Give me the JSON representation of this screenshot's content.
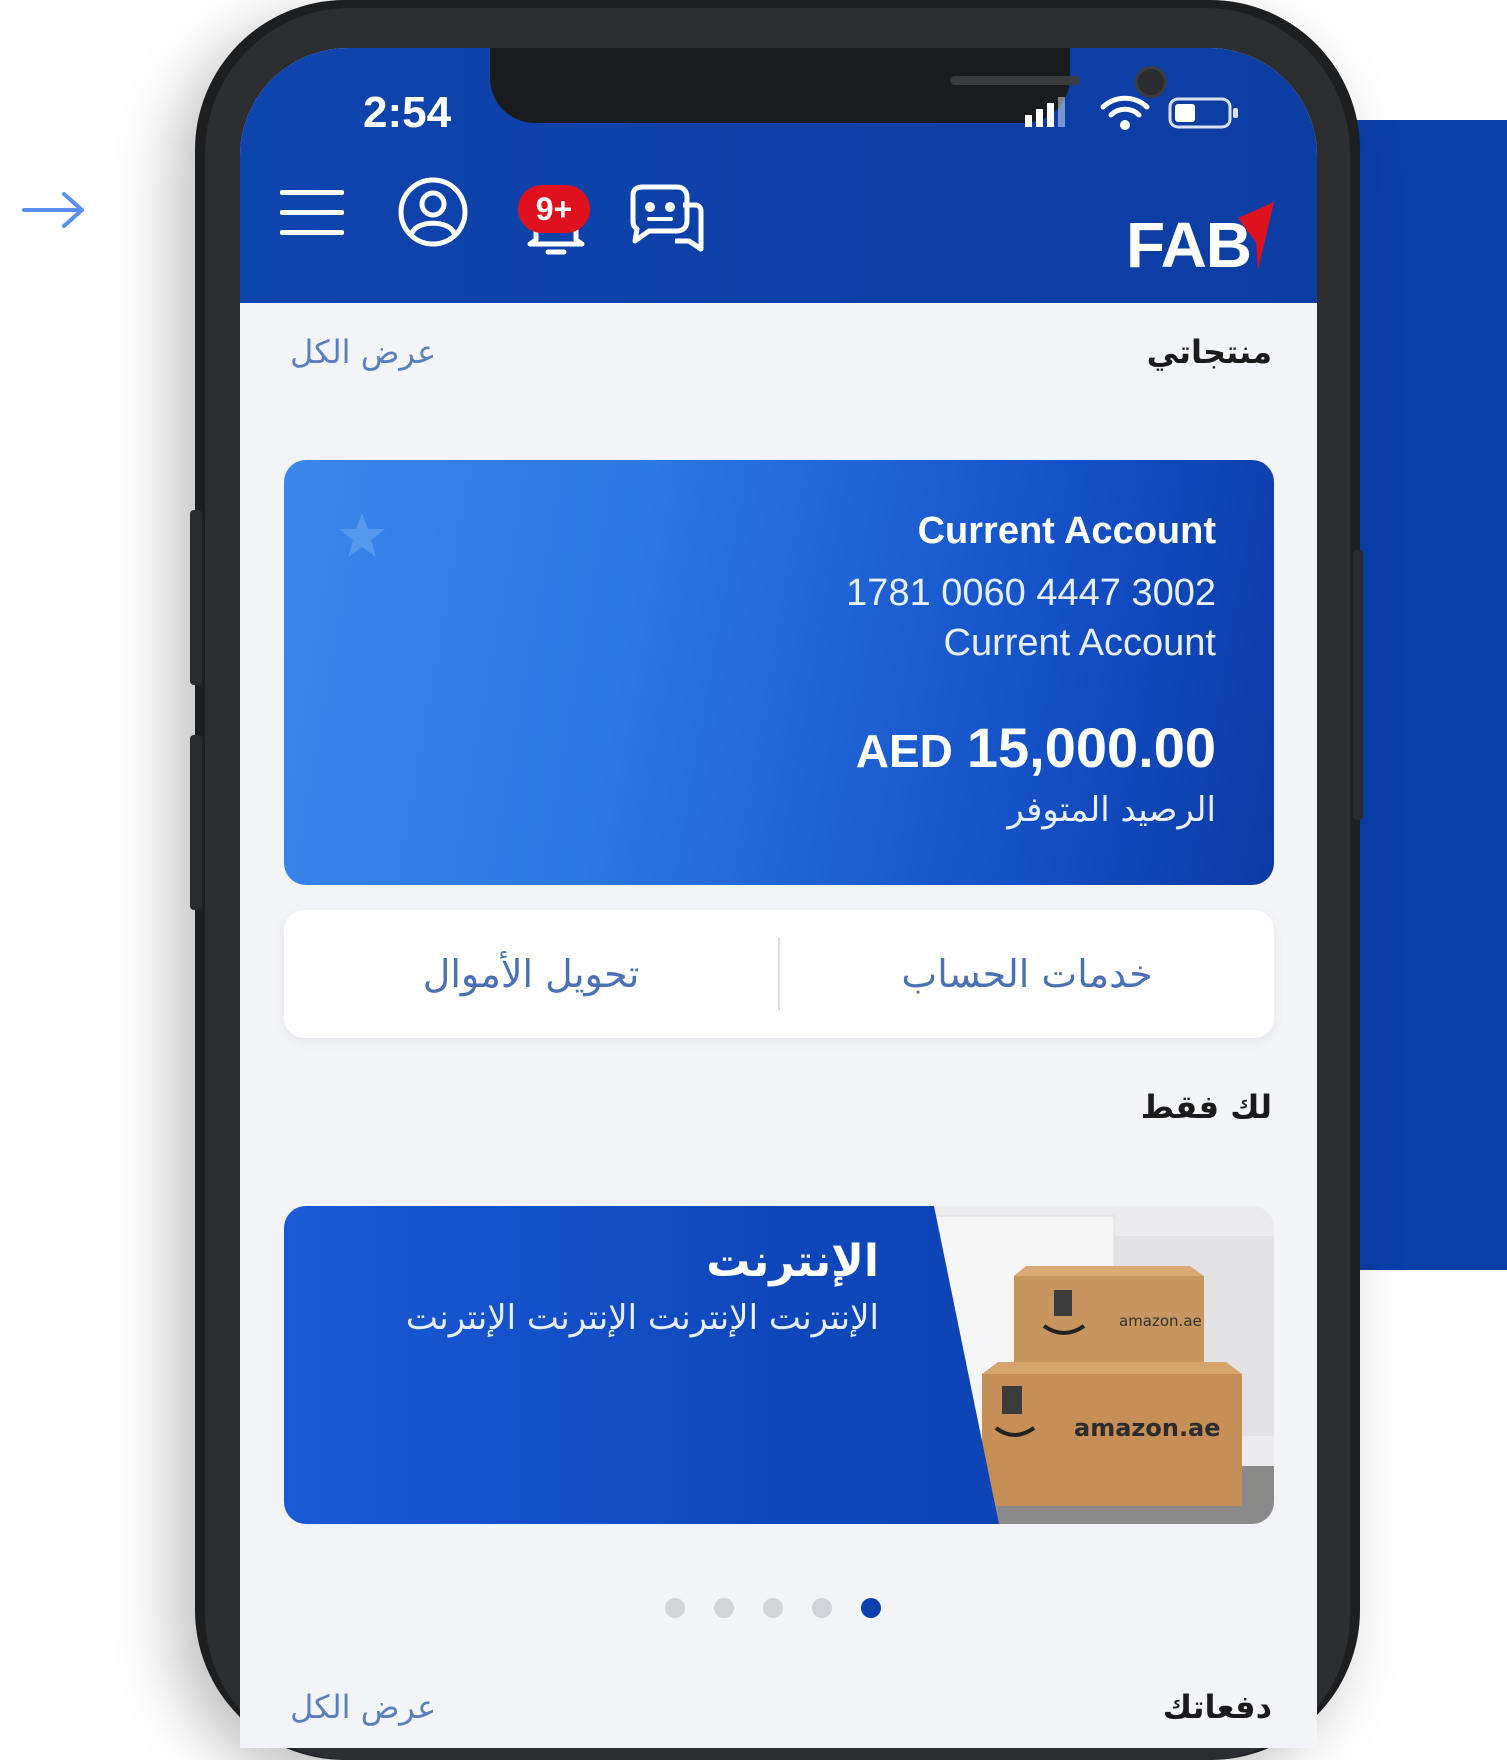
{
  "status_bar": {
    "time": "2:54"
  },
  "header": {
    "logo_text": "FAB",
    "notification_badge": "9+",
    "icons": [
      "menu-icon",
      "profile-icon",
      "bell-icon",
      "chatbot-icon"
    ]
  },
  "products": {
    "title": "منتجاتي",
    "view_all": "عرض الكل",
    "account": {
      "name": "Current Account",
      "number": "1781 0060 4447 3002",
      "type": "Current Account",
      "currency": "AED",
      "amount": "15,000.00",
      "available_label": "الرصيد المتوفر"
    },
    "actions": {
      "account_services": "خدمات الحساب",
      "transfer_funds": "تحويل الأموال"
    }
  },
  "for_you": {
    "title": "لك فقط",
    "promo": {
      "title": "الإنترنت",
      "subtitle": "الإنترنت الإنترنت الإنترنت الإنترنت",
      "image_text_1": "amazon.ae",
      "image_text_2": "amazon.ae"
    },
    "pagination": {
      "count": 5,
      "active_index": 4
    }
  },
  "payments": {
    "title": "دفعاتك",
    "view_all": "عرض الكل"
  },
  "colors": {
    "brand_blue": "#0e44ad",
    "badge_red": "#e0111f",
    "link_blue": "#4a71b3"
  }
}
